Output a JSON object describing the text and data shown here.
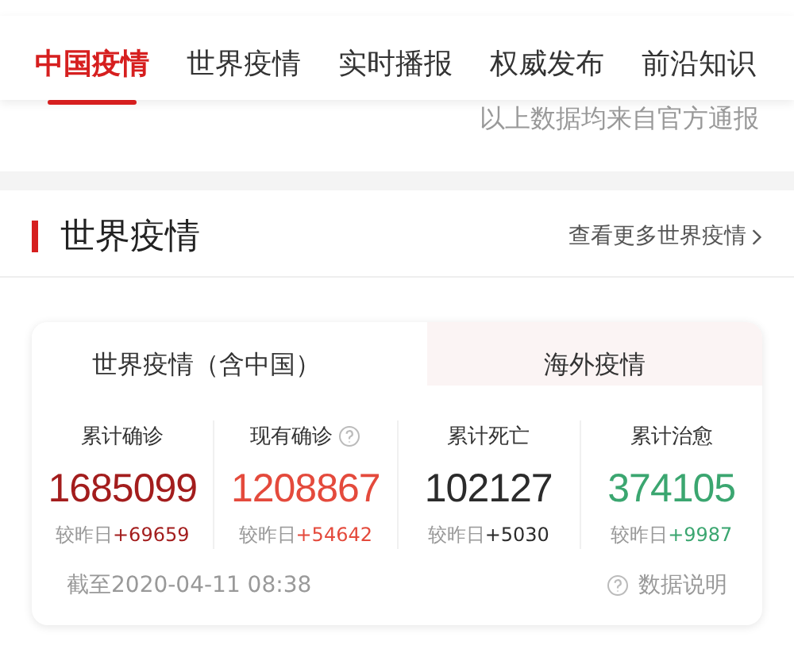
{
  "nav_tabs": [
    {
      "label": "中国疫情",
      "selected": true
    },
    {
      "label": "世界疫情",
      "selected": false
    },
    {
      "label": "实时播报",
      "selected": false
    },
    {
      "label": "权威发布",
      "selected": false
    },
    {
      "label": "前沿知识",
      "selected": false
    }
  ],
  "source_note": "以上数据均来自官方通报",
  "section": {
    "title": "世界疫情",
    "more_link": "查看更多世界疫情"
  },
  "scope_tabs": [
    {
      "label": "世界疫情（含中国）",
      "selected": true
    },
    {
      "label": "海外疫情",
      "selected": false
    }
  ],
  "stats": [
    {
      "label": "累计确诊",
      "help": false,
      "value": "1685099",
      "delta_label": "较昨日",
      "delta": "+69659",
      "color": "#a31d1d"
    },
    {
      "label": "现有确诊",
      "help": true,
      "value": "1208867",
      "delta_label": "较昨日",
      "delta": "+54642",
      "color": "#e44a3c"
    },
    {
      "label": "累计死亡",
      "help": false,
      "value": "102127",
      "delta_label": "较昨日",
      "delta": "+5030",
      "color": "#2b2b2b"
    },
    {
      "label": "累计治愈",
      "help": false,
      "value": "374105",
      "delta_label": "较昨日",
      "delta": "+9987",
      "color": "#3ba670"
    }
  ],
  "footer": {
    "timestamp": "截至2020-04-11 08:38",
    "explain_link": "数据说明"
  }
}
